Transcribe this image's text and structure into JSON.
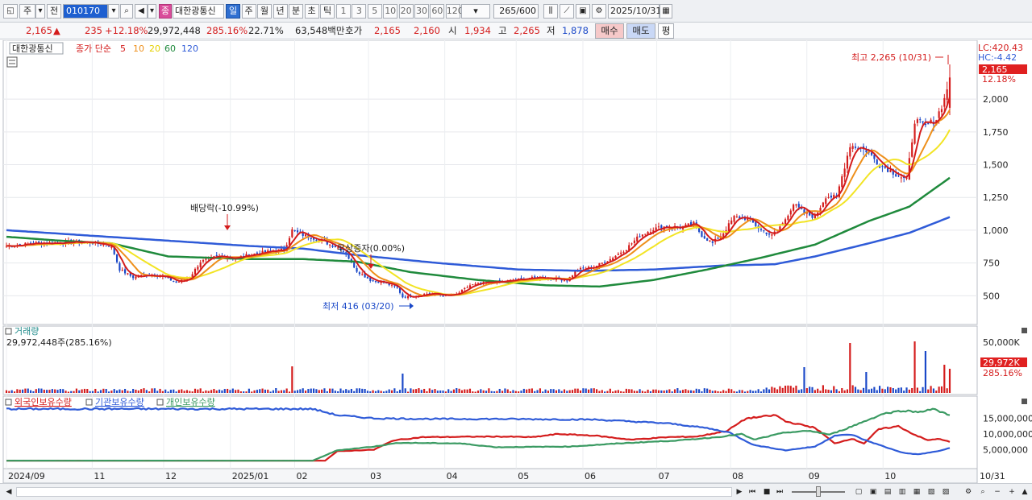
{
  "toolbar": {
    "market_label": "주",
    "prev_label": "전",
    "code": "010170",
    "stock_badge": "종",
    "stock_name": "대한광통신",
    "periods": [
      "일",
      "주",
      "월",
      "년",
      "분",
      "초",
      "틱"
    ],
    "active_period": "일",
    "intervals": [
      "1",
      "3",
      "5",
      "10",
      "20",
      "30",
      "60",
      "120"
    ],
    "count": "265",
    "count_total": "/600",
    "date": "2025/10/31"
  },
  "quote": {
    "price": "2,165",
    "change_arrow": "▲",
    "change": "235",
    "change_pct": "+12.18%",
    "volume": "29,972,448",
    "volume_ratio": "285.16%",
    "turnover": "22.71%",
    "amount": "63,548백만",
    "bid_label": "호가",
    "ask_price": "2,165",
    "bid_price": "2,160",
    "open_label": "시",
    "open": "1,934",
    "high_label": "고",
    "high": "2,265",
    "low_label": "저",
    "low": "1,878",
    "buy_label": "매수",
    "sell_label": "매도",
    "eval_label": "평"
  },
  "colors": {
    "up": "#d41c1c",
    "down": "#1a48c8",
    "ma5": "#d41c1c",
    "ma10": "#ee8f1a",
    "ma20": "#f2e424",
    "ma60": "#1f8a3c",
    "ma120": "#2f5bd8",
    "foreign": "#d41c1c",
    "institution": "#2f5bd8",
    "individual": "#3a9a62"
  },
  "chart_data": [
    {
      "type": "candlestick",
      "title": "대한광통신",
      "legend": {
        "prefix": "종가 단순",
        "periods": [
          "5",
          "10",
          "20",
          "60",
          "120"
        ]
      },
      "yticks": [
        2000,
        1750,
        1500,
        1250,
        1000,
        750,
        500
      ],
      "ytick_labels": [
        "2,000",
        "1,750",
        "1,500",
        "1,250",
        "1,000",
        "750",
        "500"
      ],
      "ylim": [
        330,
        2400
      ],
      "xticks": [
        "2024/09",
        "11",
        "12",
        "2025/01",
        "02",
        "03",
        "04",
        "05",
        "06",
        "07",
        "08",
        "09",
        "10",
        "10/31"
      ],
      "lc_label": "LC:420.43",
      "hc_label": "HC:-4.42",
      "current_price_label": "2,165",
      "current_change_label": "12.18%",
      "annotations": {
        "high": "최고 2,265 (10/31)",
        "low": "최저 416 (03/20)",
        "dividend": "배당락(-10.99%)",
        "capital": "무상증자(0.00%)"
      },
      "series_anchors": {
        "close": [
          [
            0,
            880
          ],
          [
            10,
            900
          ],
          [
            20,
            905
          ],
          [
            30,
            910
          ],
          [
            39,
            880
          ],
          [
            42,
            700
          ],
          [
            47,
            640
          ],
          [
            52,
            660
          ],
          [
            58,
            650
          ],
          [
            63,
            600
          ],
          [
            68,
            640
          ],
          [
            72,
            760
          ],
          [
            78,
            800
          ],
          [
            85,
            790
          ],
          [
            92,
            820
          ],
          [
            98,
            840
          ],
          [
            103,
            850
          ],
          [
            106,
            1000
          ],
          [
            109,
            970
          ],
          [
            114,
            940
          ],
          [
            119,
            900
          ],
          [
            124,
            860
          ],
          [
            126,
            820
          ],
          [
            130,
            690
          ],
          [
            135,
            620
          ],
          [
            140,
            600
          ],
          [
            145,
            560
          ],
          [
            147,
            490
          ],
          [
            152,
            500
          ],
          [
            157,
            520
          ],
          [
            162,
            500
          ],
          [
            167,
            510
          ],
          [
            172,
            580
          ],
          [
            178,
            600
          ],
          [
            185,
            610
          ],
          [
            192,
            630
          ],
          [
            198,
            640
          ],
          [
            204,
            630
          ],
          [
            208,
            620
          ],
          [
            212,
            700
          ],
          [
            218,
            720
          ],
          [
            224,
            780
          ],
          [
            230,
            860
          ],
          [
            235,
            960
          ],
          [
            240,
            1010
          ],
          [
            245,
            1030
          ],
          [
            250,
            1020
          ],
          [
            255,
            1050
          ],
          [
            258,
            960
          ],
          [
            262,
            900
          ],
          [
            266,
            980
          ],
          [
            270,
            1100
          ],
          [
            275,
            1090
          ],
          [
            280,
            1000
          ],
          [
            284,
            960
          ],
          [
            288,
            1050
          ],
          [
            292,
            1200
          ],
          [
            296,
            1130
          ],
          [
            300,
            1100
          ],
          [
            304,
            1260
          ],
          [
            308,
            1250
          ],
          [
            313,
            1650
          ],
          [
            319,
            1610
          ],
          [
            324,
            1500
          ],
          [
            330,
            1430
          ],
          [
            334,
            1380
          ],
          [
            337,
            1840
          ],
          [
            341,
            1790
          ],
          [
            345,
            1850
          ],
          [
            348,
            2000
          ],
          [
            350,
            2165
          ]
        ],
        "ma60": [
          [
            0,
            950
          ],
          [
            20,
            920
          ],
          [
            39,
            900
          ],
          [
            60,
            800
          ],
          [
            90,
            780
          ],
          [
            110,
            780
          ],
          [
            130,
            760
          ],
          [
            150,
            680
          ],
          [
            175,
            620
          ],
          [
            200,
            580
          ],
          [
            220,
            570
          ],
          [
            240,
            620
          ],
          [
            260,
            700
          ],
          [
            280,
            790
          ],
          [
            300,
            890
          ],
          [
            320,
            1070
          ],
          [
            335,
            1180
          ],
          [
            350,
            1400
          ]
        ],
        "ma120": [
          [
            0,
            1000
          ],
          [
            30,
            960
          ],
          [
            60,
            920
          ],
          [
            90,
            880
          ],
          [
            110,
            860
          ],
          [
            130,
            810
          ],
          [
            160,
            750
          ],
          [
            190,
            700
          ],
          [
            215,
            690
          ],
          [
            240,
            700
          ],
          [
            265,
            730
          ],
          [
            285,
            740
          ],
          [
            300,
            800
          ],
          [
            320,
            900
          ],
          [
            335,
            980
          ],
          [
            350,
            1100
          ]
        ]
      },
      "volume_panel": {
        "label": "거래량",
        "info": "29,972,448주(285.16%)",
        "ytick_label": "50,000K",
        "current_label": "29,972K",
        "current_ratio_label": "285.16%",
        "spikes": [
          [
            106,
            33000
          ],
          [
            147,
            24000
          ],
          [
            296,
            32000
          ],
          [
            313,
            62000
          ],
          [
            319,
            26000
          ],
          [
            337,
            64000
          ],
          [
            341,
            52000
          ],
          [
            348,
            35000
          ],
          [
            350,
            29972
          ]
        ]
      },
      "holdings_panel": {
        "legend": [
          "외국인보유수량",
          "기관보유수량",
          "개인보유수량"
        ],
        "yticks": [
          15000000,
          10000000,
          5000000
        ],
        "ytick_labels": [
          "15,000,000",
          "10,000,000",
          "5,000,000"
        ],
        "series": [
          {
            "name": "외국인보유수량",
            "anchors": [
              [
                0,
                1500000
              ],
              [
                130,
                1500000
              ],
              [
                135,
                4500000
              ],
              [
                150,
                5000000
              ],
              [
                158,
                8000000
              ],
              [
                170,
                9000000
              ],
              [
                200,
                9200000
              ],
              [
                215,
                9000000
              ],
              [
                225,
                10000000
              ],
              [
                240,
                9500000
              ],
              [
                255,
                8200000
              ],
              [
                270,
                9000000
              ],
              [
                282,
                9200000
              ],
              [
                294,
                11000000
              ],
              [
                302,
                15000000
              ],
              [
                314,
                16000000
              ],
              [
                318,
                14000000
              ],
              [
                330,
                12000000
              ],
              [
                338,
                7000000
              ],
              [
                345,
                8500000
              ],
              [
                350,
                7000000
              ],
              [
                356,
                11500000
              ],
              [
                364,
                12500000
              ],
              [
                370,
                10000000
              ],
              [
                376,
                8000000
              ],
              [
                380,
                8500000
              ],
              [
                385,
                7500000
              ]
            ]
          },
          {
            "name": "기관보유수량",
            "anchors": [
              [
                0,
                18000000
              ],
              [
                125,
                18000000
              ],
              [
                135,
                16000000
              ],
              [
                150,
                15000000
              ],
              [
                175,
                14800000
              ],
              [
                200,
                14800000
              ],
              [
                240,
                14600000
              ],
              [
                270,
                13400000
              ],
              [
                285,
                12000000
              ],
              [
                295,
                10500000
              ],
              [
                305,
                6500000
              ],
              [
                318,
                4800000
              ],
              [
                330,
                6000000
              ],
              [
                338,
                9500000
              ],
              [
                345,
                9800000
              ],
              [
                350,
                8200000
              ],
              [
                360,
                5500000
              ],
              [
                366,
                4000000
              ],
              [
                372,
                3500000
              ],
              [
                380,
                4500000
              ],
              [
                385,
                5500000
              ]
            ]
          },
          {
            "name": "개인보유수량",
            "anchors": [
              [
                0,
                1500000
              ],
              [
                125,
                1500000
              ],
              [
                135,
                4800000
              ],
              [
                150,
                6000000
              ],
              [
                160,
                7200000
              ],
              [
                185,
                7000000
              ],
              [
                200,
                5800000
              ],
              [
                230,
                6000000
              ],
              [
                250,
                7000000
              ],
              [
                275,
                8000000
              ],
              [
                290,
                9000000
              ],
              [
                300,
                10000000
              ],
              [
                305,
                8200000
              ],
              [
                318,
                10500000
              ],
              [
                328,
                11000000
              ],
              [
                336,
                9800000
              ],
              [
                342,
                11500000
              ],
              [
                350,
                14000000
              ],
              [
                358,
                16500000
              ],
              [
                366,
                17500000
              ],
              [
                372,
                17000000
              ],
              [
                378,
                18000000
              ],
              [
                385,
                16000000
              ]
            ]
          }
        ]
      }
    }
  ]
}
